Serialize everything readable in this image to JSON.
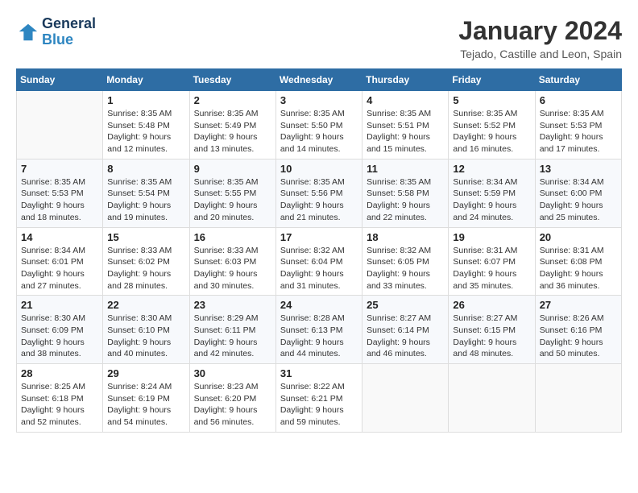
{
  "header": {
    "logo_line1": "General",
    "logo_line2": "Blue",
    "month_title": "January 2024",
    "location": "Tejado, Castille and Leon, Spain"
  },
  "weekdays": [
    "Sunday",
    "Monday",
    "Tuesday",
    "Wednesday",
    "Thursday",
    "Friday",
    "Saturday"
  ],
  "weeks": [
    [
      {
        "day": "",
        "info": ""
      },
      {
        "day": "1",
        "info": "Sunrise: 8:35 AM\nSunset: 5:48 PM\nDaylight: 9 hours\nand 12 minutes."
      },
      {
        "day": "2",
        "info": "Sunrise: 8:35 AM\nSunset: 5:49 PM\nDaylight: 9 hours\nand 13 minutes."
      },
      {
        "day": "3",
        "info": "Sunrise: 8:35 AM\nSunset: 5:50 PM\nDaylight: 9 hours\nand 14 minutes."
      },
      {
        "day": "4",
        "info": "Sunrise: 8:35 AM\nSunset: 5:51 PM\nDaylight: 9 hours\nand 15 minutes."
      },
      {
        "day": "5",
        "info": "Sunrise: 8:35 AM\nSunset: 5:52 PM\nDaylight: 9 hours\nand 16 minutes."
      },
      {
        "day": "6",
        "info": "Sunrise: 8:35 AM\nSunset: 5:53 PM\nDaylight: 9 hours\nand 17 minutes."
      }
    ],
    [
      {
        "day": "7",
        "info": "Sunrise: 8:35 AM\nSunset: 5:53 PM\nDaylight: 9 hours\nand 18 minutes."
      },
      {
        "day": "8",
        "info": "Sunrise: 8:35 AM\nSunset: 5:54 PM\nDaylight: 9 hours\nand 19 minutes."
      },
      {
        "day": "9",
        "info": "Sunrise: 8:35 AM\nSunset: 5:55 PM\nDaylight: 9 hours\nand 20 minutes."
      },
      {
        "day": "10",
        "info": "Sunrise: 8:35 AM\nSunset: 5:56 PM\nDaylight: 9 hours\nand 21 minutes."
      },
      {
        "day": "11",
        "info": "Sunrise: 8:35 AM\nSunset: 5:58 PM\nDaylight: 9 hours\nand 22 minutes."
      },
      {
        "day": "12",
        "info": "Sunrise: 8:34 AM\nSunset: 5:59 PM\nDaylight: 9 hours\nand 24 minutes."
      },
      {
        "day": "13",
        "info": "Sunrise: 8:34 AM\nSunset: 6:00 PM\nDaylight: 9 hours\nand 25 minutes."
      }
    ],
    [
      {
        "day": "14",
        "info": "Sunrise: 8:34 AM\nSunset: 6:01 PM\nDaylight: 9 hours\nand 27 minutes."
      },
      {
        "day": "15",
        "info": "Sunrise: 8:33 AM\nSunset: 6:02 PM\nDaylight: 9 hours\nand 28 minutes."
      },
      {
        "day": "16",
        "info": "Sunrise: 8:33 AM\nSunset: 6:03 PM\nDaylight: 9 hours\nand 30 minutes."
      },
      {
        "day": "17",
        "info": "Sunrise: 8:32 AM\nSunset: 6:04 PM\nDaylight: 9 hours\nand 31 minutes."
      },
      {
        "day": "18",
        "info": "Sunrise: 8:32 AM\nSunset: 6:05 PM\nDaylight: 9 hours\nand 33 minutes."
      },
      {
        "day": "19",
        "info": "Sunrise: 8:31 AM\nSunset: 6:07 PM\nDaylight: 9 hours\nand 35 minutes."
      },
      {
        "day": "20",
        "info": "Sunrise: 8:31 AM\nSunset: 6:08 PM\nDaylight: 9 hours\nand 36 minutes."
      }
    ],
    [
      {
        "day": "21",
        "info": "Sunrise: 8:30 AM\nSunset: 6:09 PM\nDaylight: 9 hours\nand 38 minutes."
      },
      {
        "day": "22",
        "info": "Sunrise: 8:30 AM\nSunset: 6:10 PM\nDaylight: 9 hours\nand 40 minutes."
      },
      {
        "day": "23",
        "info": "Sunrise: 8:29 AM\nSunset: 6:11 PM\nDaylight: 9 hours\nand 42 minutes."
      },
      {
        "day": "24",
        "info": "Sunrise: 8:28 AM\nSunset: 6:13 PM\nDaylight: 9 hours\nand 44 minutes."
      },
      {
        "day": "25",
        "info": "Sunrise: 8:27 AM\nSunset: 6:14 PM\nDaylight: 9 hours\nand 46 minutes."
      },
      {
        "day": "26",
        "info": "Sunrise: 8:27 AM\nSunset: 6:15 PM\nDaylight: 9 hours\nand 48 minutes."
      },
      {
        "day": "27",
        "info": "Sunrise: 8:26 AM\nSunset: 6:16 PM\nDaylight: 9 hours\nand 50 minutes."
      }
    ],
    [
      {
        "day": "28",
        "info": "Sunrise: 8:25 AM\nSunset: 6:18 PM\nDaylight: 9 hours\nand 52 minutes."
      },
      {
        "day": "29",
        "info": "Sunrise: 8:24 AM\nSunset: 6:19 PM\nDaylight: 9 hours\nand 54 minutes."
      },
      {
        "day": "30",
        "info": "Sunrise: 8:23 AM\nSunset: 6:20 PM\nDaylight: 9 hours\nand 56 minutes."
      },
      {
        "day": "31",
        "info": "Sunrise: 8:22 AM\nSunset: 6:21 PM\nDaylight: 9 hours\nand 59 minutes."
      },
      {
        "day": "",
        "info": ""
      },
      {
        "day": "",
        "info": ""
      },
      {
        "day": "",
        "info": ""
      }
    ]
  ]
}
